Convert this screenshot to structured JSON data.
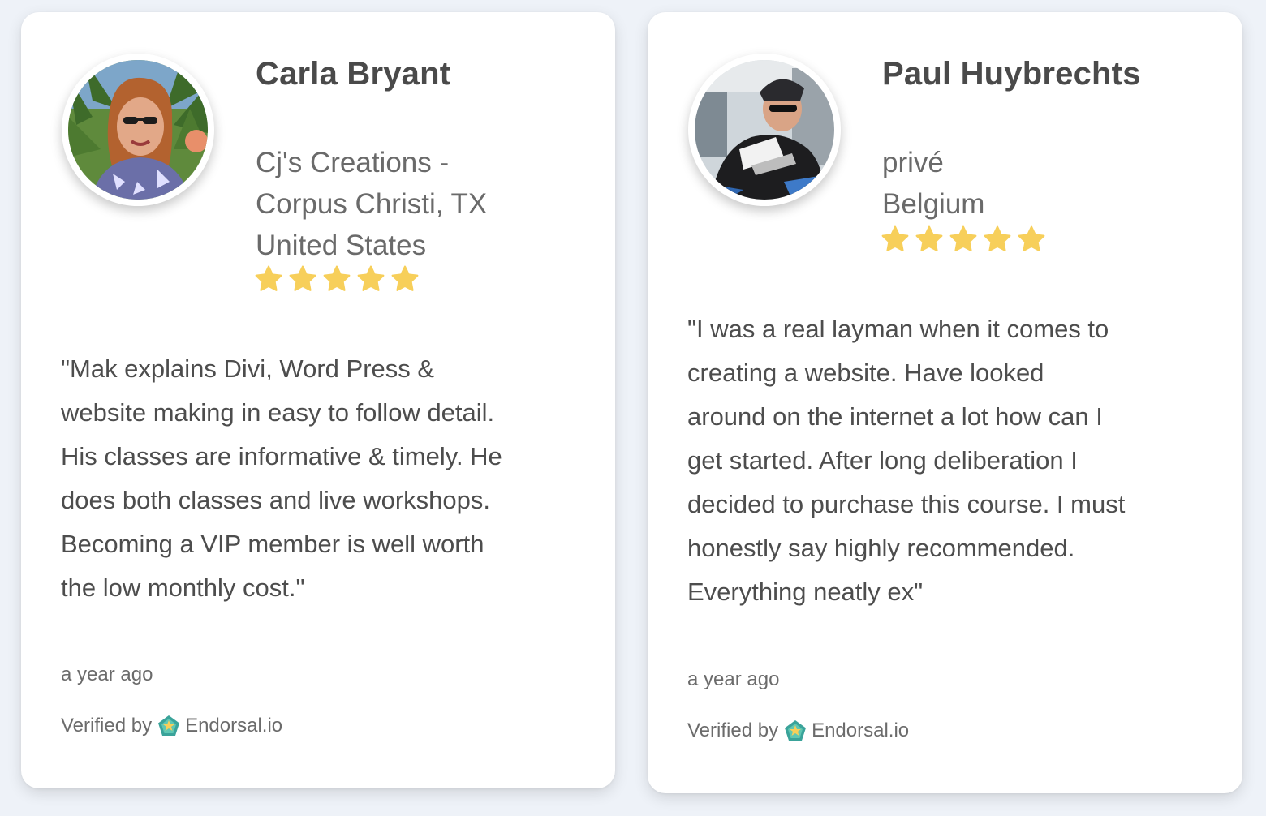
{
  "colors": {
    "background": "#eef2f8",
    "card": "#ffffff",
    "star": "#f7cf5a",
    "name_text": "#4a4a4a",
    "body_text": "#4d4d4d",
    "muted_text": "#6b6b6b"
  },
  "testimonials": [
    {
      "name": "Carla Bryant",
      "company_lines": [
        "Cj's Creations -",
        "Corpus Christi, TX",
        "United States"
      ],
      "rating": 5,
      "rating_max": 5,
      "review_lines": [
        "\"Mak explains Divi, Word Press &",
        "website making in easy to follow detail.",
        "His classes are informative & timely. He",
        "does both classes and live workshops.",
        "Becoming a VIP member is well worth",
        "the low monthly cost.\""
      ],
      "time": "a year ago",
      "verified_label": "Verified by",
      "verified_brand": "Endorsal.io",
      "verified_icon": "endorsal-logo-icon"
    },
    {
      "name": "Paul Huybrechts",
      "company_lines": [
        "privé",
        "Belgium"
      ],
      "rating": 5,
      "rating_max": 5,
      "review_lines": [
        "\"I was a real layman when it comes to",
        "creating a website. Have looked",
        "around on the internet a lot how can I",
        "get started. After long deliberation I",
        "decided to purchase this course. I must",
        "honestly say highly recommended.",
        "Everything neatly ex\""
      ],
      "time": "a year ago",
      "verified_label": "Verified by",
      "verified_brand": "Endorsal.io",
      "verified_icon": "endorsal-logo-icon"
    }
  ]
}
